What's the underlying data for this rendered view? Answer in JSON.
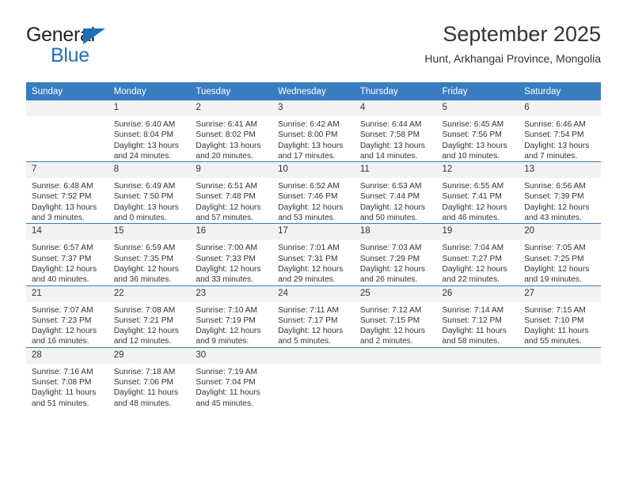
{
  "brand": {
    "name_top": "General",
    "name_bottom": "Blue",
    "triangle_color": "#1b72b8"
  },
  "header": {
    "title": "September 2025",
    "subtitle": "Hunt, Arkhangai Province, Mongolia"
  },
  "theme": {
    "header_bg": "#3a7cc0",
    "daynum_bg": "#f2f2f2",
    "text": "#333333",
    "accent": "#1b72b8"
  },
  "weekday_headers": [
    "Sunday",
    "Monday",
    "Tuesday",
    "Wednesday",
    "Thursday",
    "Friday",
    "Saturday"
  ],
  "labels": {
    "sunrise_prefix": "Sunrise: ",
    "sunset_prefix": "Sunset: ",
    "daylight_prefix": "Daylight: "
  },
  "weeks": [
    [
      {
        "day": "",
        "sunrise": "",
        "sunset": "",
        "daylight_line1": "",
        "daylight_line2": ""
      },
      {
        "day": "1",
        "sunrise": "Sunrise: 6:40 AM",
        "sunset": "Sunset: 8:04 PM",
        "daylight_line1": "Daylight: 13 hours",
        "daylight_line2": "and 24 minutes."
      },
      {
        "day": "2",
        "sunrise": "Sunrise: 6:41 AM",
        "sunset": "Sunset: 8:02 PM",
        "daylight_line1": "Daylight: 13 hours",
        "daylight_line2": "and 20 minutes."
      },
      {
        "day": "3",
        "sunrise": "Sunrise: 6:42 AM",
        "sunset": "Sunset: 8:00 PM",
        "daylight_line1": "Daylight: 13 hours",
        "daylight_line2": "and 17 minutes."
      },
      {
        "day": "4",
        "sunrise": "Sunrise: 6:44 AM",
        "sunset": "Sunset: 7:58 PM",
        "daylight_line1": "Daylight: 13 hours",
        "daylight_line2": "and 14 minutes."
      },
      {
        "day": "5",
        "sunrise": "Sunrise: 6:45 AM",
        "sunset": "Sunset: 7:56 PM",
        "daylight_line1": "Daylight: 13 hours",
        "daylight_line2": "and 10 minutes."
      },
      {
        "day": "6",
        "sunrise": "Sunrise: 6:46 AM",
        "sunset": "Sunset: 7:54 PM",
        "daylight_line1": "Daylight: 13 hours",
        "daylight_line2": "and 7 minutes."
      }
    ],
    [
      {
        "day": "7",
        "sunrise": "Sunrise: 6:48 AM",
        "sunset": "Sunset: 7:52 PM",
        "daylight_line1": "Daylight: 13 hours",
        "daylight_line2": "and 3 minutes."
      },
      {
        "day": "8",
        "sunrise": "Sunrise: 6:49 AM",
        "sunset": "Sunset: 7:50 PM",
        "daylight_line1": "Daylight: 13 hours",
        "daylight_line2": "and 0 minutes."
      },
      {
        "day": "9",
        "sunrise": "Sunrise: 6:51 AM",
        "sunset": "Sunset: 7:48 PM",
        "daylight_line1": "Daylight: 12 hours",
        "daylight_line2": "and 57 minutes."
      },
      {
        "day": "10",
        "sunrise": "Sunrise: 6:52 AM",
        "sunset": "Sunset: 7:46 PM",
        "daylight_line1": "Daylight: 12 hours",
        "daylight_line2": "and 53 minutes."
      },
      {
        "day": "11",
        "sunrise": "Sunrise: 6:53 AM",
        "sunset": "Sunset: 7:44 PM",
        "daylight_line1": "Daylight: 12 hours",
        "daylight_line2": "and 50 minutes."
      },
      {
        "day": "12",
        "sunrise": "Sunrise: 6:55 AM",
        "sunset": "Sunset: 7:41 PM",
        "daylight_line1": "Daylight: 12 hours",
        "daylight_line2": "and 46 minutes."
      },
      {
        "day": "13",
        "sunrise": "Sunrise: 6:56 AM",
        "sunset": "Sunset: 7:39 PM",
        "daylight_line1": "Daylight: 12 hours",
        "daylight_line2": "and 43 minutes."
      }
    ],
    [
      {
        "day": "14",
        "sunrise": "Sunrise: 6:57 AM",
        "sunset": "Sunset: 7:37 PM",
        "daylight_line1": "Daylight: 12 hours",
        "daylight_line2": "and 40 minutes."
      },
      {
        "day": "15",
        "sunrise": "Sunrise: 6:59 AM",
        "sunset": "Sunset: 7:35 PM",
        "daylight_line1": "Daylight: 12 hours",
        "daylight_line2": "and 36 minutes."
      },
      {
        "day": "16",
        "sunrise": "Sunrise: 7:00 AM",
        "sunset": "Sunset: 7:33 PM",
        "daylight_line1": "Daylight: 12 hours",
        "daylight_line2": "and 33 minutes."
      },
      {
        "day": "17",
        "sunrise": "Sunrise: 7:01 AM",
        "sunset": "Sunset: 7:31 PM",
        "daylight_line1": "Daylight: 12 hours",
        "daylight_line2": "and 29 minutes."
      },
      {
        "day": "18",
        "sunrise": "Sunrise: 7:03 AM",
        "sunset": "Sunset: 7:29 PM",
        "daylight_line1": "Daylight: 12 hours",
        "daylight_line2": "and 26 minutes."
      },
      {
        "day": "19",
        "sunrise": "Sunrise: 7:04 AM",
        "sunset": "Sunset: 7:27 PM",
        "daylight_line1": "Daylight: 12 hours",
        "daylight_line2": "and 22 minutes."
      },
      {
        "day": "20",
        "sunrise": "Sunrise: 7:05 AM",
        "sunset": "Sunset: 7:25 PM",
        "daylight_line1": "Daylight: 12 hours",
        "daylight_line2": "and 19 minutes."
      }
    ],
    [
      {
        "day": "21",
        "sunrise": "Sunrise: 7:07 AM",
        "sunset": "Sunset: 7:23 PM",
        "daylight_line1": "Daylight: 12 hours",
        "daylight_line2": "and 16 minutes."
      },
      {
        "day": "22",
        "sunrise": "Sunrise: 7:08 AM",
        "sunset": "Sunset: 7:21 PM",
        "daylight_line1": "Daylight: 12 hours",
        "daylight_line2": "and 12 minutes."
      },
      {
        "day": "23",
        "sunrise": "Sunrise: 7:10 AM",
        "sunset": "Sunset: 7:19 PM",
        "daylight_line1": "Daylight: 12 hours",
        "daylight_line2": "and 9 minutes."
      },
      {
        "day": "24",
        "sunrise": "Sunrise: 7:11 AM",
        "sunset": "Sunset: 7:17 PM",
        "daylight_line1": "Daylight: 12 hours",
        "daylight_line2": "and 5 minutes."
      },
      {
        "day": "25",
        "sunrise": "Sunrise: 7:12 AM",
        "sunset": "Sunset: 7:15 PM",
        "daylight_line1": "Daylight: 12 hours",
        "daylight_line2": "and 2 minutes."
      },
      {
        "day": "26",
        "sunrise": "Sunrise: 7:14 AM",
        "sunset": "Sunset: 7:12 PM",
        "daylight_line1": "Daylight: 11 hours",
        "daylight_line2": "and 58 minutes."
      },
      {
        "day": "27",
        "sunrise": "Sunrise: 7:15 AM",
        "sunset": "Sunset: 7:10 PM",
        "daylight_line1": "Daylight: 11 hours",
        "daylight_line2": "and 55 minutes."
      }
    ],
    [
      {
        "day": "28",
        "sunrise": "Sunrise: 7:16 AM",
        "sunset": "Sunset: 7:08 PM",
        "daylight_line1": "Daylight: 11 hours",
        "daylight_line2": "and 51 minutes."
      },
      {
        "day": "29",
        "sunrise": "Sunrise: 7:18 AM",
        "sunset": "Sunset: 7:06 PM",
        "daylight_line1": "Daylight: 11 hours",
        "daylight_line2": "and 48 minutes."
      },
      {
        "day": "30",
        "sunrise": "Sunrise: 7:19 AM",
        "sunset": "Sunset: 7:04 PM",
        "daylight_line1": "Daylight: 11 hours",
        "daylight_line2": "and 45 minutes."
      },
      {
        "day": "",
        "sunrise": "",
        "sunset": "",
        "daylight_line1": "",
        "daylight_line2": ""
      },
      {
        "day": "",
        "sunrise": "",
        "sunset": "",
        "daylight_line1": "",
        "daylight_line2": ""
      },
      {
        "day": "",
        "sunrise": "",
        "sunset": "",
        "daylight_line1": "",
        "daylight_line2": ""
      },
      {
        "day": "",
        "sunrise": "",
        "sunset": "",
        "daylight_line1": "",
        "daylight_line2": ""
      }
    ]
  ]
}
